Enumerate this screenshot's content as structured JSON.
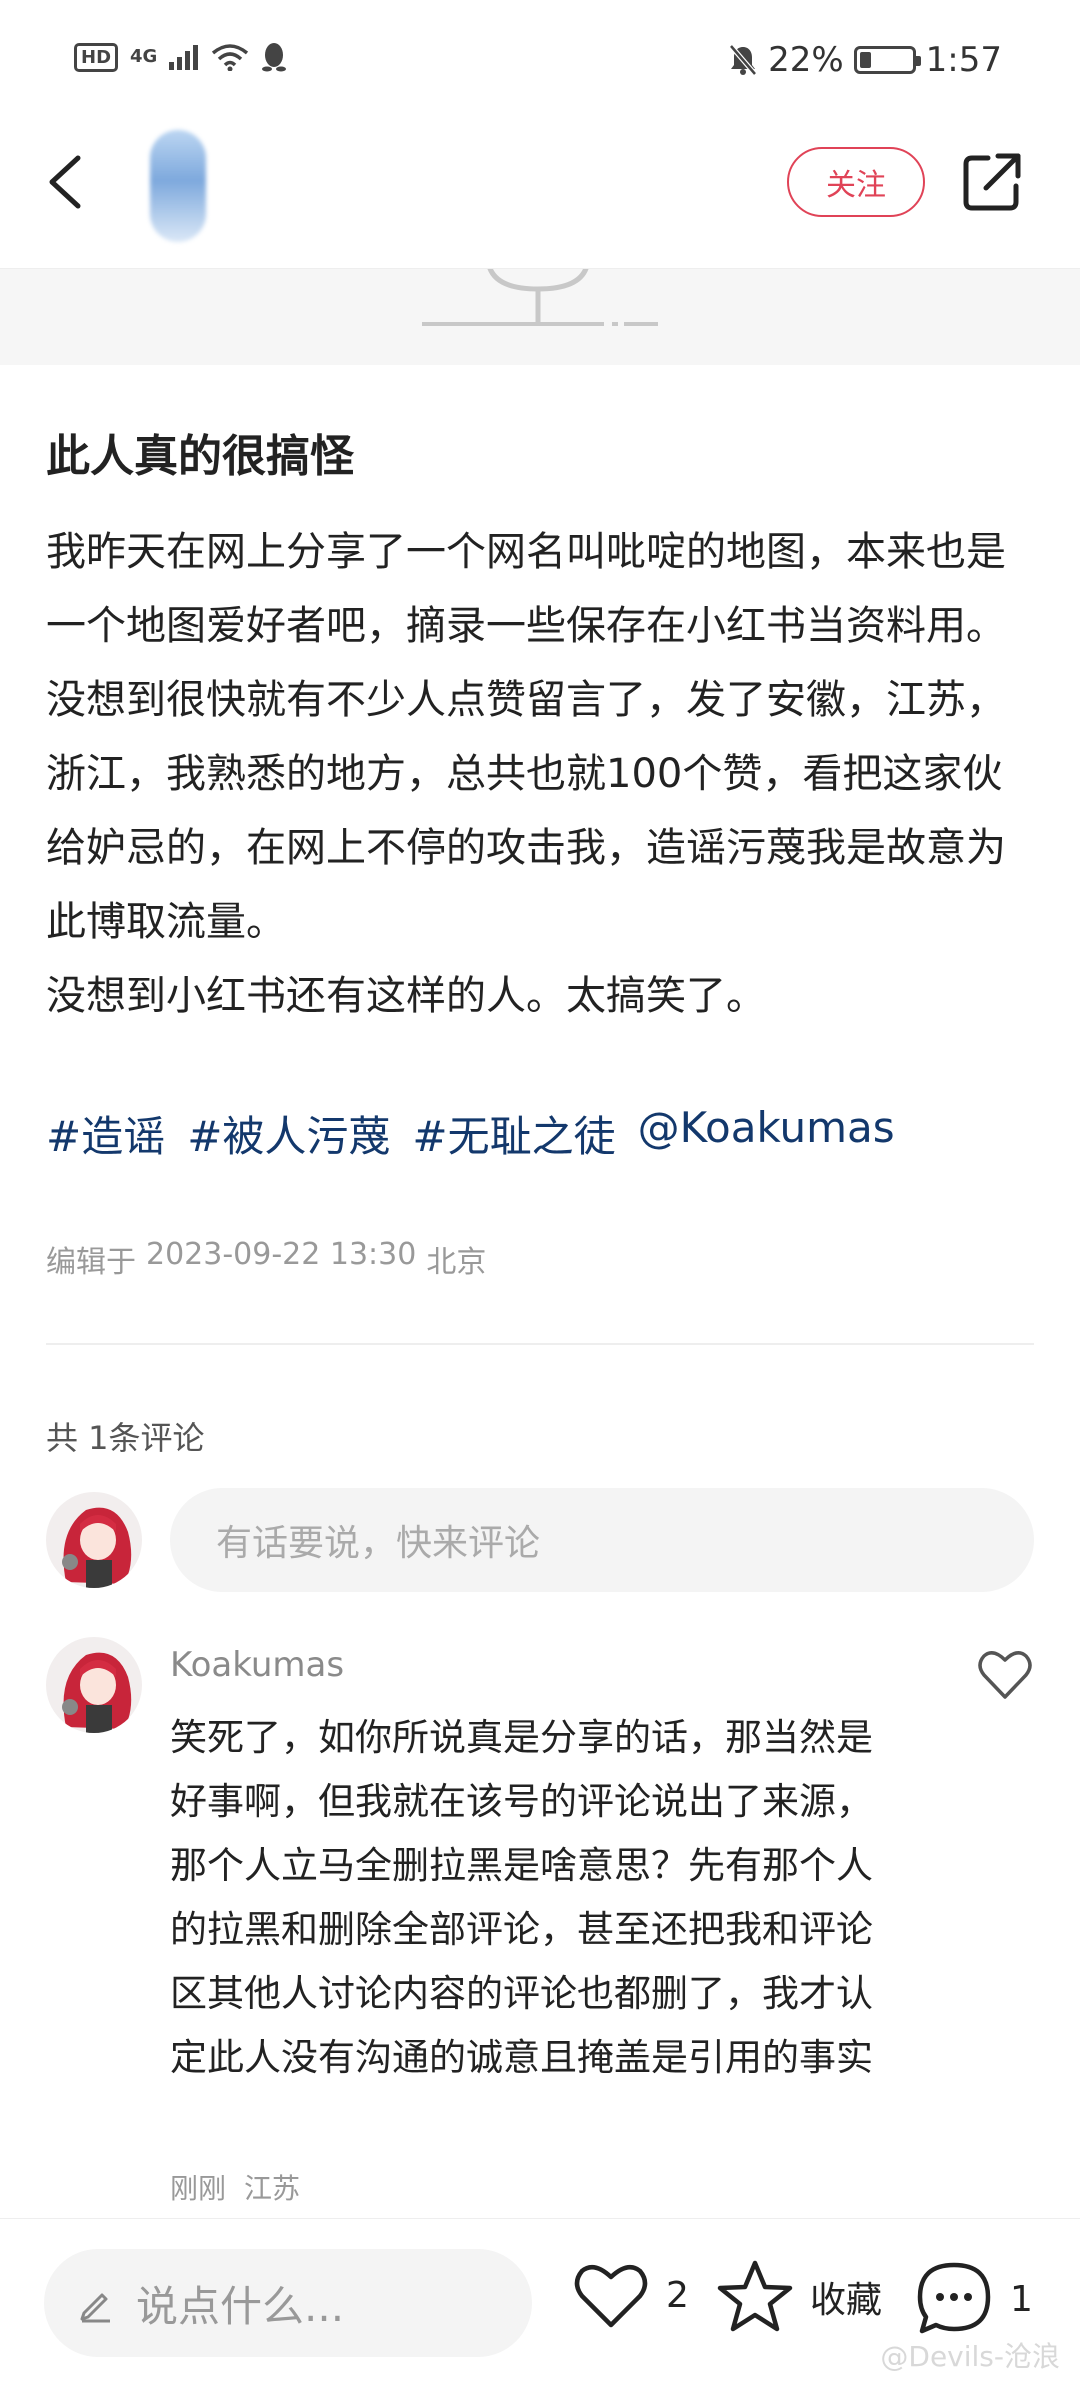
{
  "status_bar": {
    "hd": "HD",
    "network": "4G",
    "battery_percent": "22%",
    "battery_level": 0.22,
    "time": "1:57"
  },
  "nav": {
    "follow_label": "关注"
  },
  "post": {
    "title": "此人真的很搞怪",
    "body": [
      "我昨天在网上分享了一个网名叫吡啶的地图，本来也是一个地图爱好者吧，摘录一些保存在小红书当资料用。",
      "没想到很快就有不少人点赞留言了，发了安徽，江苏，浙江，我熟悉的地方，总共也就100个赞，看把这家伙给妒忌的，在网上不停的攻击我，造谣污蔑我是故意为此博取流量。",
      "没想到小红书还有这样的人。太搞笑了。"
    ],
    "tags": [
      "#造谣",
      "#被人污蔑",
      "#无耻之徒",
      "@Koakumas"
    ],
    "edit_prefix": "编辑于",
    "edit_date": "2023-09-22 13:30",
    "edit_location": "北京"
  },
  "comments": {
    "count_label": "共 1条评论",
    "input_placeholder": "有话要说，快来评论",
    "items": [
      {
        "author": "Koakumas",
        "text": "笑死了，如你所说真是分享的话，那当然是好事啊，但我就在该号的评论说出了来源，那个人立马全删拉黑是啥意思？先有那个人的拉黑和删除全部评论，甚至还把我和评论区其他人讨论内容的评论也都删了，我才认定此人没有沟通的诚意且掩盖是引用的事实",
        "time": "刚刚",
        "location": "江苏"
      }
    ]
  },
  "bottom_bar": {
    "say_placeholder": "说点什么...",
    "likes": "2",
    "collect_label": "收藏",
    "comments": "1"
  },
  "watermark": "@Devils-沧浪",
  "colors": {
    "accent": "#e04357",
    "tag": "#13386c",
    "muted": "#999999"
  }
}
